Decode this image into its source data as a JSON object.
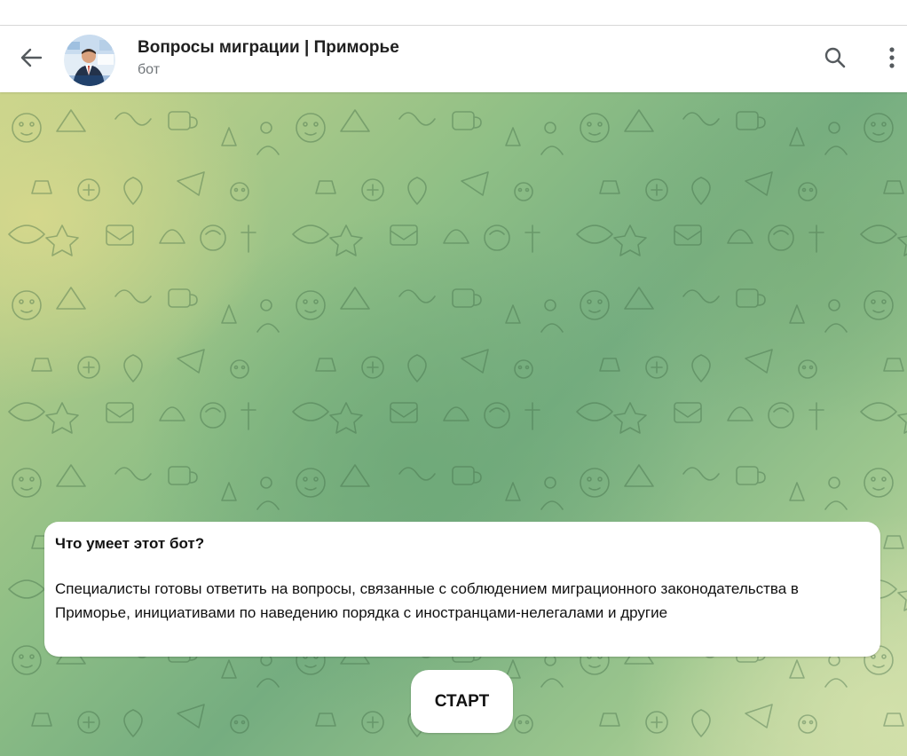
{
  "header": {
    "title": "Вопросы миграции | Приморье",
    "subtitle": "бот"
  },
  "icons": {
    "back": "arrow-left-icon",
    "search": "search-icon",
    "menu": "more-vertical-icon"
  },
  "bot_info": {
    "heading": "Что умеет этот бот?",
    "description": "Специалисты готовы ответить на вопросы, связанные с соблюдением миграционного законодательства в Приморье, инициативами по наведению порядка с иностранцами-нелегалами и другие"
  },
  "start_button": {
    "label": "СТАРТ"
  },
  "colors": {
    "header_bg": "#ffffff",
    "title_text": "#1f1f1f",
    "subtitle_text": "#707579",
    "icon": "#555a5e",
    "bubble_bg": "#ffffff",
    "wallpaper_green": "#75ad80",
    "wallpaper_yellow": "#c8d48c"
  }
}
